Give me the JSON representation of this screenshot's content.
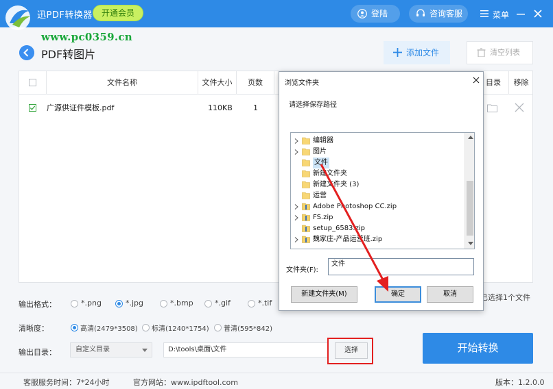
{
  "app": {
    "name": "迅捷PDF转换器",
    "display_name": "迅PDF转换器",
    "vip_button": "开通会员",
    "login": "登陆",
    "service": "咨询客服",
    "menu": "菜单",
    "watermark": "www.pc0359.cn",
    "accent_color": "#2e8ae6"
  },
  "page": {
    "title": "PDF转图片",
    "add_file": "添加文件",
    "clear_list": "清空列表"
  },
  "table": {
    "headers": {
      "name": "文件名称",
      "size": "文件大小",
      "pages": "页数",
      "dir": "目录",
      "remove": "移除"
    },
    "rows": [
      {
        "checked": true,
        "name": "广源供证件模板.pdf",
        "size": "110KB",
        "pages": "1"
      }
    ],
    "selected_count": "已选择1个文件"
  },
  "options": {
    "format_label": "输出格式：",
    "formats": [
      "*.png",
      "*.jpg",
      "*.bmp",
      "*.gif",
      "*.tif"
    ],
    "selected_format": "*.jpg",
    "clarity_label": "清晰度：",
    "clarities": [
      "高清(2479*3508)",
      "标清(1240*1754)",
      "普清(595*842)"
    ],
    "selected_clarity": "高清(2479*3508)",
    "dir_label": "输出目录：",
    "dir_mode": "自定义目录",
    "dir_path": "D:\\tools\\桌面\\文件",
    "choose": "选择",
    "start": "开始转换"
  },
  "footer": {
    "hours": "客服服务时间：7*24小时",
    "site": "官方网站：www.ipdftool.com",
    "version": "版本：1.2.0.0"
  },
  "dialog": {
    "title": "浏览文件夹",
    "prompt": "请选择保存路径",
    "tree": [
      {
        "label": "编辑器",
        "type": "folder",
        "expandable": true
      },
      {
        "label": "图片",
        "type": "folder",
        "expandable": true
      },
      {
        "label": "文件",
        "type": "folder",
        "expandable": false,
        "selected": true
      },
      {
        "label": "新建文件夹",
        "type": "folder",
        "expandable": false
      },
      {
        "label": "新建文件夹 (3)",
        "type": "folder",
        "expandable": false
      },
      {
        "label": "运营",
        "type": "folder",
        "expandable": false
      },
      {
        "label": "Adobe Photoshop CC.zip",
        "type": "zip",
        "expandable": true
      },
      {
        "label": "FS.zip",
        "type": "zip",
        "expandable": true
      },
      {
        "label": "setup_6583.zip",
        "type": "zip",
        "expandable": false
      },
      {
        "label": "魏家庄-产品运营班.zip",
        "type": "zip",
        "expandable": true
      }
    ],
    "folder_label": "文件夹(F):",
    "folder_value": "文件",
    "new_folder": "新建文件夹(M)",
    "ok": "确定",
    "cancel": "取消"
  }
}
